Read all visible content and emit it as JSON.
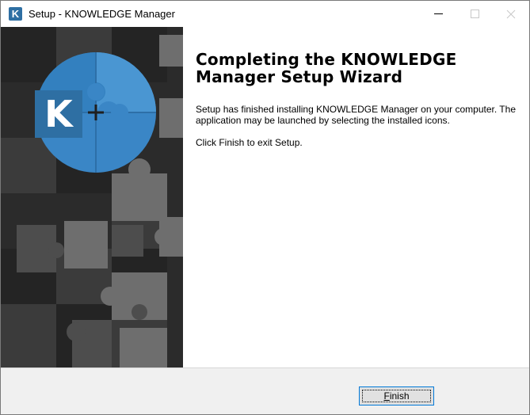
{
  "window": {
    "title": "Setup - KNOWLEDGE Manager",
    "icon_letter": "K"
  },
  "banner": {
    "logo_letter": "K",
    "colors": {
      "dark": "#2b2b2b",
      "mid": "#3d3d3d",
      "light": "#6b6b6b",
      "puzzle_blue": "#3a86c6",
      "puzzle_blue_light": "#5aa3dc",
      "logo_bg": "#2e6fa3"
    }
  },
  "main": {
    "heading": "Completing the KNOWLEDGE Manager Setup Wizard",
    "paragraph1": "Setup has finished installing KNOWLEDGE Manager on your computer. The application may be launched by selecting the installed icons.",
    "paragraph2": "Click Finish to exit Setup."
  },
  "footer": {
    "finish_label_accel": "F",
    "finish_label_rest": "inish"
  }
}
